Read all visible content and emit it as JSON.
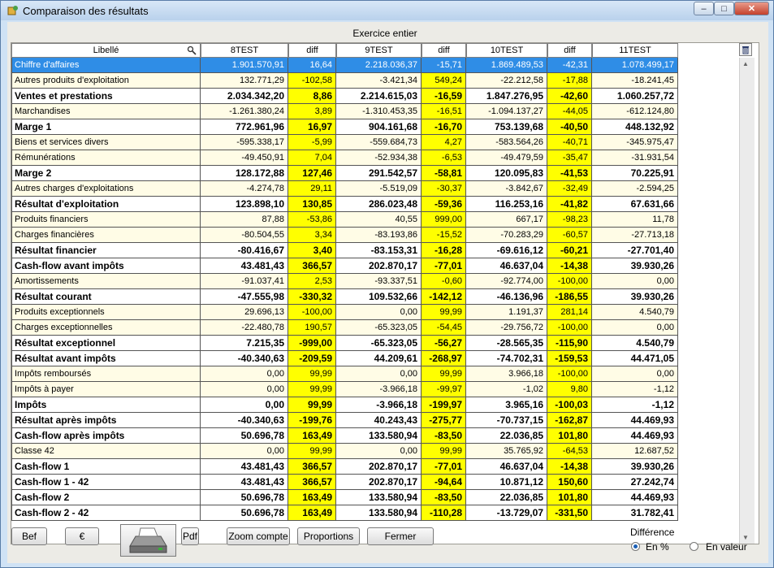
{
  "window": {
    "title": "Comparaison des résultats",
    "minimize": "–",
    "maximize": "□",
    "close": "✕"
  },
  "section_title": "Exercice entier",
  "columns": [
    "Libellé",
    "8TEST",
    "diff",
    "9TEST",
    "diff",
    "10TEST",
    "diff",
    "11TEST"
  ],
  "rows": [
    {
      "label": "Chiffre d'affaires",
      "bold": false,
      "selected": true,
      "v": [
        "1.901.570,91",
        "16,64",
        "2.218.036,37",
        "-15,71",
        "1.869.489,53",
        "-42,31",
        "1.078.499,17"
      ]
    },
    {
      "label": "Autres produits d'exploitation",
      "bold": false,
      "v": [
        "132.771,29",
        "-102,58",
        "-3.421,34",
        "549,24",
        "-22.212,58",
        "-17,88",
        "-18.241,45"
      ]
    },
    {
      "label": "Ventes et prestations",
      "bold": true,
      "v": [
        "2.034.342,20",
        "8,86",
        "2.214.615,03",
        "-16,59",
        "1.847.276,95",
        "-42,60",
        "1.060.257,72"
      ]
    },
    {
      "label": "Marchandises",
      "bold": false,
      "v": [
        "-1.261.380,24",
        "3,89",
        "-1.310.453,35",
        "-16,51",
        "-1.094.137,27",
        "-44,05",
        "-612.124,80"
      ]
    },
    {
      "label": "Marge 1",
      "bold": true,
      "v": [
        "772.961,96",
        "16,97",
        "904.161,68",
        "-16,70",
        "753.139,68",
        "-40,50",
        "448.132,92"
      ]
    },
    {
      "label": "Biens et services divers",
      "bold": false,
      "v": [
        "-595.338,17",
        "-5,99",
        "-559.684,73",
        "4,27",
        "-583.564,26",
        "-40,71",
        "-345.975,47"
      ]
    },
    {
      "label": "Rémunérations",
      "bold": false,
      "v": [
        "-49.450,91",
        "7,04",
        "-52.934,38",
        "-6,53",
        "-49.479,59",
        "-35,47",
        "-31.931,54"
      ]
    },
    {
      "label": "Marge 2",
      "bold": true,
      "v": [
        "128.172,88",
        "127,46",
        "291.542,57",
        "-58,81",
        "120.095,83",
        "-41,53",
        "70.225,91"
      ]
    },
    {
      "label": "Autres charges d'exploitations",
      "bold": false,
      "v": [
        "-4.274,78",
        "29,11",
        "-5.519,09",
        "-30,37",
        "-3.842,67",
        "-32,49",
        "-2.594,25"
      ]
    },
    {
      "label": "Résultat d'exploitation",
      "bold": true,
      "v": [
        "123.898,10",
        "130,85",
        "286.023,48",
        "-59,36",
        "116.253,16",
        "-41,82",
        "67.631,66"
      ]
    },
    {
      "label": "Produits financiers",
      "bold": false,
      "v": [
        "87,88",
        "-53,86",
        "40,55",
        "999,00",
        "667,17",
        "-98,23",
        "11,78"
      ]
    },
    {
      "label": "Charges financières",
      "bold": false,
      "v": [
        "-80.504,55",
        "3,34",
        "-83.193,86",
        "-15,52",
        "-70.283,29",
        "-60,57",
        "-27.713,18"
      ]
    },
    {
      "label": "Résultat financier",
      "bold": true,
      "v": [
        "-80.416,67",
        "3,40",
        "-83.153,31",
        "-16,28",
        "-69.616,12",
        "-60,21",
        "-27.701,40"
      ]
    },
    {
      "label": "Cash-flow avant impôts",
      "bold": true,
      "v": [
        "43.481,43",
        "366,57",
        "202.870,17",
        "-77,01",
        "46.637,04",
        "-14,38",
        "39.930,26"
      ]
    },
    {
      "label": "Amortissements",
      "bold": false,
      "v": [
        "-91.037,41",
        "2,53",
        "-93.337,51",
        "-0,60",
        "-92.774,00",
        "-100,00",
        "0,00"
      ]
    },
    {
      "label": "Résultat courant",
      "bold": true,
      "v": [
        "-47.555,98",
        "-330,32",
        "109.532,66",
        "-142,12",
        "-46.136,96",
        "-186,55",
        "39.930,26"
      ]
    },
    {
      "label": "Produits exceptionnels",
      "bold": false,
      "v": [
        "29.696,13",
        "-100,00",
        "0,00",
        "99,99",
        "1.191,37",
        "281,14",
        "4.540,79"
      ]
    },
    {
      "label": "Charges exceptionnelles",
      "bold": false,
      "v": [
        "-22.480,78",
        "190,57",
        "-65.323,05",
        "-54,45",
        "-29.756,72",
        "-100,00",
        "0,00"
      ]
    },
    {
      "label": "Résultat exceptionnel",
      "bold": true,
      "v": [
        "7.215,35",
        "-999,00",
        "-65.323,05",
        "-56,27",
        "-28.565,35",
        "-115,90",
        "4.540,79"
      ]
    },
    {
      "label": "Résultat avant impôts",
      "bold": true,
      "v": [
        "-40.340,63",
        "-209,59",
        "44.209,61",
        "-268,97",
        "-74.702,31",
        "-159,53",
        "44.471,05"
      ]
    },
    {
      "label": "Impôts remboursés",
      "bold": false,
      "v": [
        "0,00",
        "99,99",
        "0,00",
        "99,99",
        "3.966,18",
        "-100,00",
        "0,00"
      ]
    },
    {
      "label": "Impôts à payer",
      "bold": false,
      "v": [
        "0,00",
        "99,99",
        "-3.966,18",
        "-99,97",
        "-1,02",
        "9,80",
        "-1,12"
      ]
    },
    {
      "label": "Impôts",
      "bold": true,
      "v": [
        "0,00",
        "99,99",
        "-3.966,18",
        "-199,97",
        "3.965,16",
        "-100,03",
        "-1,12"
      ]
    },
    {
      "label": "Résultat après impôts",
      "bold": true,
      "v": [
        "-40.340,63",
        "-199,76",
        "40.243,43",
        "-275,77",
        "-70.737,15",
        "-162,87",
        "44.469,93"
      ]
    },
    {
      "label": "Cash-flow après impôts",
      "bold": true,
      "v": [
        "50.696,78",
        "163,49",
        "133.580,94",
        "-83,50",
        "22.036,85",
        "101,80",
        "44.469,93"
      ]
    },
    {
      "label": "Classe 42",
      "bold": false,
      "v": [
        "0,00",
        "99,99",
        "0,00",
        "99,99",
        "35.765,92",
        "-64,53",
        "12.687,52"
      ]
    },
    {
      "label": "Cash-flow 1",
      "bold": true,
      "v": [
        "43.481,43",
        "366,57",
        "202.870,17",
        "-77,01",
        "46.637,04",
        "-14,38",
        "39.930,26"
      ]
    },
    {
      "label": "Cash-flow 1 - 42",
      "bold": true,
      "v": [
        "43.481,43",
        "366,57",
        "202.870,17",
        "-94,64",
        "10.871,12",
        "150,60",
        "27.242,74"
      ]
    },
    {
      "label": "Cash-flow 2",
      "bold": true,
      "v": [
        "50.696,78",
        "163,49",
        "133.580,94",
        "-83,50",
        "22.036,85",
        "101,80",
        "44.469,93"
      ]
    },
    {
      "label": "Cash-flow 2 - 42",
      "bold": true,
      "v": [
        "50.696,78",
        "163,49",
        "133.580,94",
        "-110,28",
        "-13.729,07",
        "-331,50",
        "31.782,41"
      ]
    }
  ],
  "buttons": {
    "bef": "Bef",
    "euro": "€",
    "pdf": "Pdf",
    "zoom": "Zoom compte",
    "proportions": "Proportions",
    "fermer": "Fermer"
  },
  "difference": {
    "label": "Différence",
    "pct": "En %",
    "value": "En valeur",
    "selected": "pct"
  }
}
